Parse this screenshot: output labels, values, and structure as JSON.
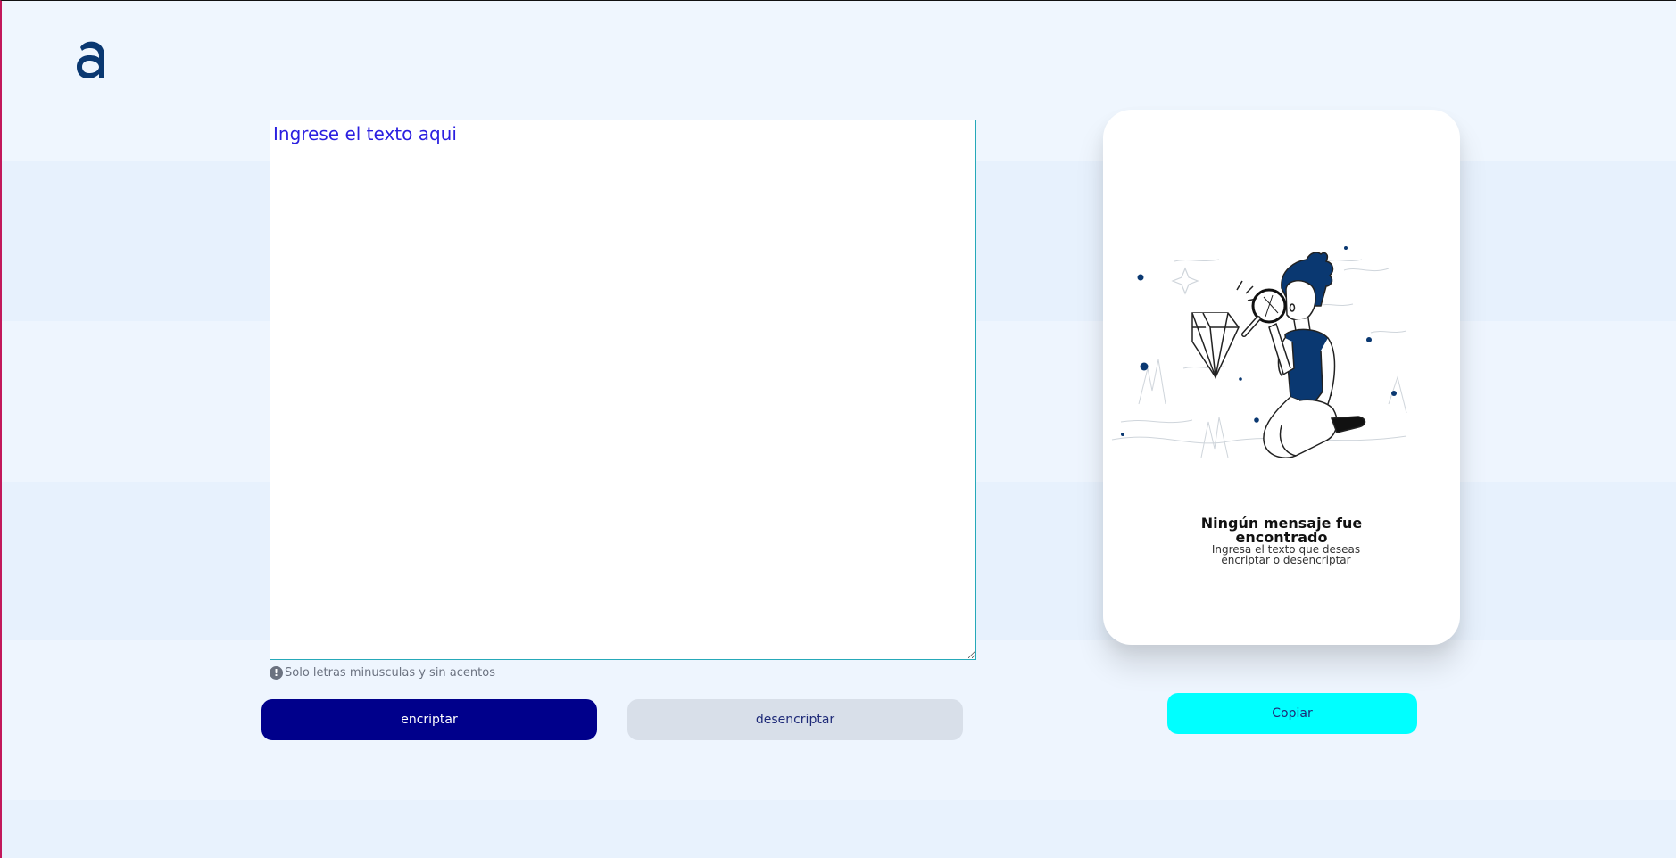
{
  "header": {
    "logo_icon": "alura-a-logo"
  },
  "editor": {
    "placeholder": "Ingrese el texto aqui",
    "value": ""
  },
  "hint": {
    "icon": "exclamation-circle-icon",
    "glyph": "!",
    "text": "Solo letras minusculas y sin acentos"
  },
  "actions": {
    "encrypt_label": "encriptar",
    "decrypt_label": "desencriptar"
  },
  "result": {
    "illustration": "person-with-magnifying-glass-and-diamond",
    "title": "Ningún mensaje fue encontrado",
    "text": "Ingresa el texto que deseas encriptar o desencriptar",
    "copy_label": "Copiar"
  },
  "colors": {
    "primary": "#00008b",
    "secondary": "#d8dfe9",
    "copy": "#00ffff",
    "text_input": "#2b1fe0",
    "logo": "#0a3871"
  }
}
